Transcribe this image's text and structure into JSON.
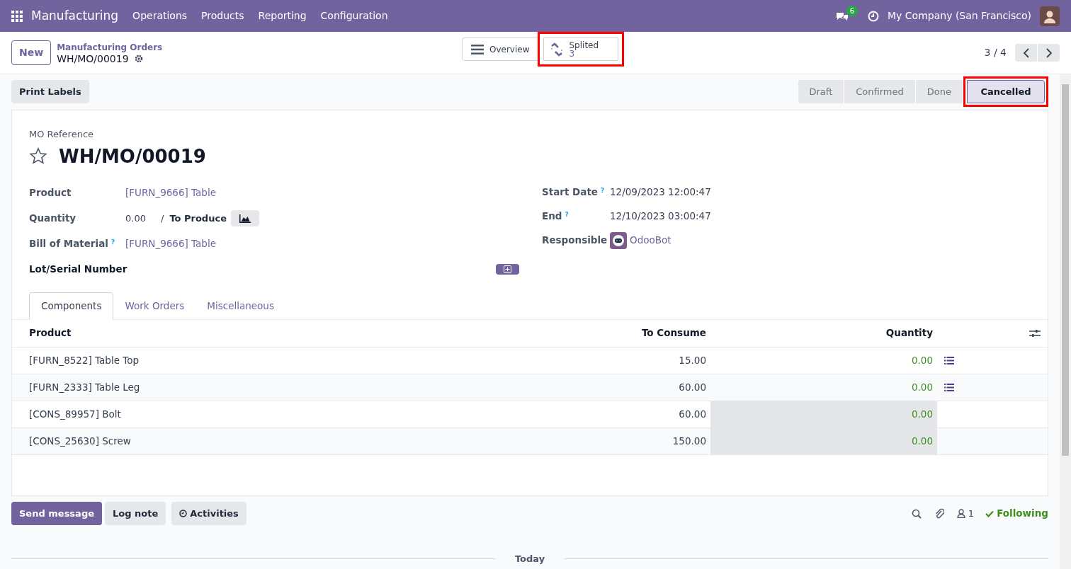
{
  "navbar": {
    "app": "Manufacturing",
    "menus": [
      "Operations",
      "Products",
      "Reporting",
      "Configuration"
    ],
    "message_count": "6",
    "company": "My Company (San Francisco)"
  },
  "control_panel": {
    "new_button": "New",
    "breadcrumb": "Manufacturing Orders",
    "record": "WH/MO/00019",
    "smart_buttons": [
      {
        "kind": "overview",
        "label": "Overview",
        "highlighted": false
      },
      {
        "kind": "split",
        "label": "Splited",
        "value": "3",
        "highlighted": true
      }
    ],
    "pager": "3 / 4"
  },
  "actions": [
    "Print Labels"
  ],
  "status_bar": [
    {
      "label": "Draft",
      "selected": false,
      "highlighted": false
    },
    {
      "label": "Confirmed",
      "selected": false,
      "highlighted": false
    },
    {
      "label": "Done",
      "selected": false,
      "highlighted": false
    },
    {
      "label": "Cancelled",
      "selected": true,
      "highlighted": true
    }
  ],
  "form": {
    "reference_label": "MO Reference",
    "starred": false,
    "name": "WH/MO/00019",
    "left_fields": [
      {
        "kind": "link",
        "label": "Product",
        "value": "[FURN_9666] Table"
      },
      {
        "kind": "quantity",
        "label": "Quantity",
        "value": "0.00",
        "suffix": "/",
        "unit": "To Produce"
      },
      {
        "kind": "link",
        "label": "Bill of Material",
        "help": "?",
        "value": "[FURN_9666] Table"
      }
    ],
    "lot_label": "Lot/Serial Number",
    "right_fields": [
      {
        "kind": "text",
        "label": "Start Date",
        "help": "?",
        "value": "12/09/2023 12:00:47"
      },
      {
        "kind": "text",
        "label": "End",
        "help": "?",
        "value": "12/10/2023 03:00:47"
      },
      {
        "kind": "user",
        "label": "Responsible",
        "value": "OdooBot"
      }
    ],
    "tabs": [
      {
        "label": "Components",
        "selected": true
      },
      {
        "label": "Work Orders",
        "selected": false
      },
      {
        "label": "Miscellaneous",
        "selected": false
      }
    ],
    "table": {
      "columns": [
        "Product",
        "To Consume",
        "Quantity"
      ],
      "rows": [
        {
          "product": "[FURN_8522] Table Top",
          "to_consume": "15.00",
          "quantity": "0.00",
          "readonly": false
        },
        {
          "product": "[FURN_2333] Table Leg",
          "to_consume": "60.00",
          "quantity": "0.00",
          "readonly": false
        },
        {
          "product": "[CONS_89957] Bolt",
          "to_consume": "60.00",
          "quantity": "0.00",
          "readonly": true
        },
        {
          "product": "[CONS_25630] Screw",
          "to_consume": "150.00",
          "quantity": "0.00",
          "readonly": true
        }
      ]
    }
  },
  "chatter": {
    "buttons": [
      {
        "label": "Send message",
        "primary": true,
        "icon": false
      },
      {
        "label": "Log note",
        "primary": false,
        "icon": false
      },
      {
        "label": "Activities",
        "primary": false,
        "icon": true
      }
    ],
    "followers": "1",
    "following": "Following",
    "divider": "Today"
  }
}
